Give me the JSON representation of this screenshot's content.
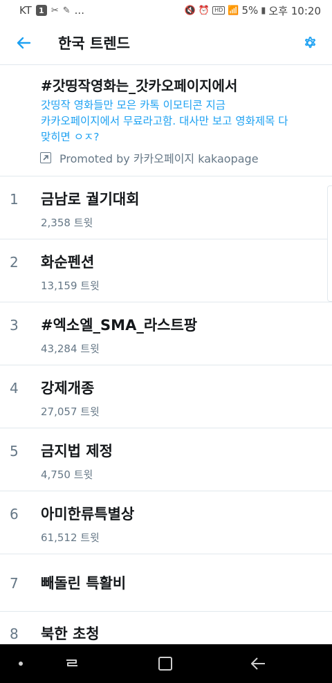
{
  "status_bar": {
    "carrier": "KT",
    "notif_badge": "1",
    "more": "...",
    "battery": "5%",
    "time": "오후 10:20"
  },
  "header": {
    "title": "한국 트렌드"
  },
  "promoted": {
    "title": "#갓띵작영화는_갓카오페이지에서",
    "description_lines": [
      "갓띵작 영화들만 모은 카톡 이모티콘 지금",
      "카카오페이지에서 무료라고함. 대사만 보고 영화제목 다",
      "맞히면 ㅇㅈ?"
    ],
    "promoted_by": "Promoted by 카카오페이지 kakaopage"
  },
  "trends": [
    {
      "rank": "1",
      "name": "금남로 궐기대회",
      "count": "2,358 트윗"
    },
    {
      "rank": "2",
      "name": "화순펜션",
      "count": "13,159 트윗"
    },
    {
      "rank": "3",
      "name": "#엑소엘_SMA_라스트팡",
      "count": "43,284 트윗"
    },
    {
      "rank": "4",
      "name": "강제개종",
      "count": "27,057 트윗"
    },
    {
      "rank": "5",
      "name": "금지법 제정",
      "count": "4,750 트윗"
    },
    {
      "rank": "6",
      "name": "아미한류특별상",
      "count": "61,512 트윗"
    },
    {
      "rank": "7",
      "name": "빼돌린 특활비",
      "count": ""
    },
    {
      "rank": "8",
      "name": "북한 초청",
      "count": ""
    }
  ],
  "colors": {
    "accent": "#1da1f2",
    "text_primary": "#14171a",
    "text_secondary": "#657786",
    "divider": "#e1e8ed"
  }
}
